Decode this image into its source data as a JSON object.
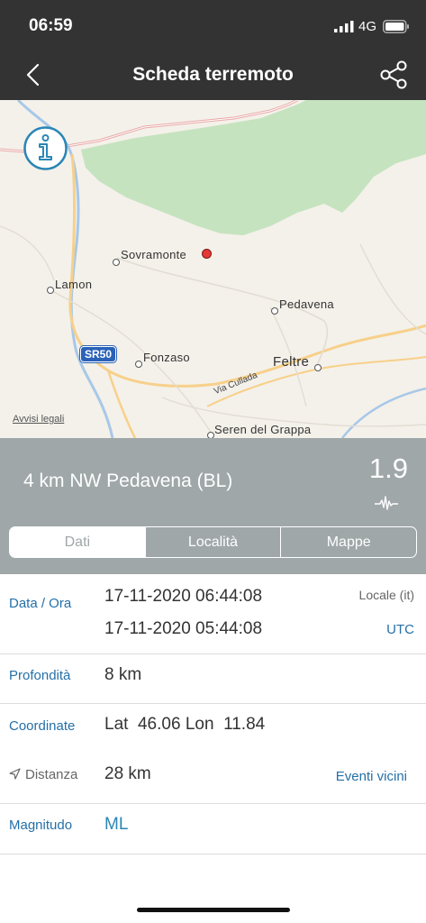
{
  "status_bar": {
    "time": "06:59",
    "network": "4G",
    "icons": [
      "cellular-signal-icon",
      "battery-icon"
    ]
  },
  "nav": {
    "title": "Scheda terremoto",
    "icons": [
      "back-chevron-icon",
      "share-icon"
    ]
  },
  "map": {
    "places": [
      "Sovramonte",
      "Lamon",
      "Pedavena",
      "Fonzaso",
      "Feltre",
      "Seren del Grappa"
    ],
    "road_badge": "SR50",
    "road_name": "Via Cullada",
    "legal_link": "Avvisi legali",
    "colors": {
      "land": "#f4f1ea",
      "forest": "#c5e3bf",
      "border": "#e8a0a0",
      "road": "#f7d08a",
      "river": "#a7c8e8",
      "epicenter": "#e53935"
    }
  },
  "event": {
    "location": "4 km NW Pedavena (BL)",
    "magnitude": "1.9"
  },
  "tabs": [
    "Dati",
    "Località",
    "Mappe"
  ],
  "details": {
    "datetime": {
      "label": "Data / Ora",
      "local_value": "17-11-2020 06:44:08",
      "local_tag": "Locale (it)",
      "utc_value": "17-11-2020 05:44:08",
      "utc_tag": "UTC"
    },
    "depth": {
      "label": "Profondità",
      "value": "8 km"
    },
    "coordinates": {
      "label": "Coordinate",
      "lat_label": "Lat",
      "lat": "46.06",
      "lon_label": "Lon",
      "lon": "11.84"
    },
    "distance": {
      "label": "Distanza",
      "value": "28 km",
      "link": "Eventi vicini"
    },
    "magnitude": {
      "label": "Magnitudo",
      "value": "ML"
    }
  },
  "colors": {
    "bar": "#333333",
    "header": "#9fa7a9",
    "accent": "#2470a8"
  }
}
